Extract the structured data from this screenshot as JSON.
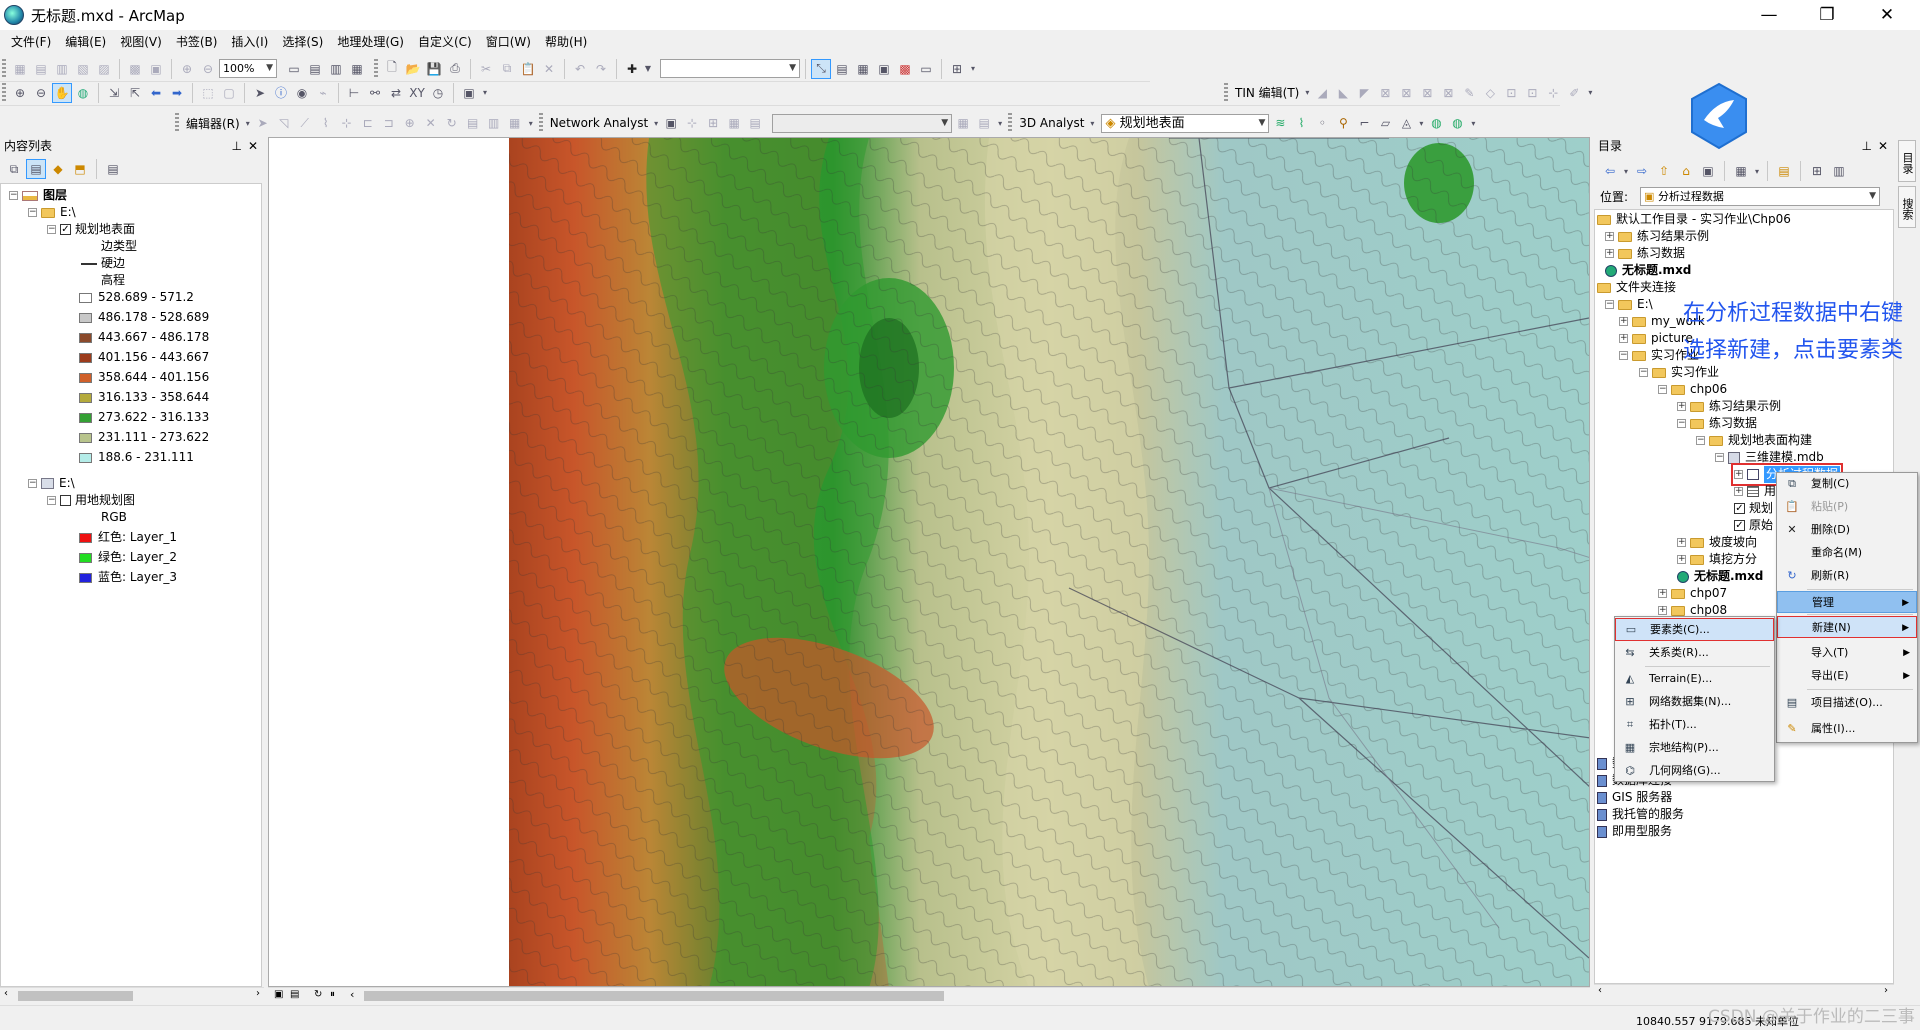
{
  "window": {
    "title": "无标题.mxd - ArcMap",
    "min": "—",
    "restore": "❐",
    "close": "✕"
  },
  "menu": [
    "文件(F)",
    "编辑(E)",
    "视图(V)",
    "书签(B)",
    "插入(I)",
    "选择(S)",
    "地理处理(G)",
    "自定义(C)",
    "窗口(W)",
    "帮助(H)"
  ],
  "toolbar": {
    "zoom": "100%",
    "tin_edit": "TIN 编辑(T)",
    "editor": "编辑器(R)",
    "network": "Network Analyst",
    "analyst3d": "3D Analyst",
    "layer": "规划地表面"
  },
  "toc": {
    "title": "内容列表",
    "root": "图层",
    "group1": "E:\\",
    "layer1": "规划地表面",
    "edge_type": "边类型",
    "hard_edge": "硬边",
    "elevation": "高程",
    "classes": [
      {
        "label": "528.689 - 571.2",
        "color": "#ffffff"
      },
      {
        "label": "486.178 - 528.689",
        "color": "#c8c8c8"
      },
      {
        "label": "443.667 - 486.178",
        "color": "#8b4a2b"
      },
      {
        "label": "401.156 - 443.667",
        "color": "#9c3c1c"
      },
      {
        "label": "358.644 - 401.156",
        "color": "#d0602a"
      },
      {
        "label": "316.133 - 358.644",
        "color": "#b4aa3c"
      },
      {
        "label": "273.622 - 316.133",
        "color": "#34a034"
      },
      {
        "label": "231.111 - 273.622",
        "color": "#b8c48c"
      },
      {
        "label": "188.6 - 231.111",
        "color": "#b4ece8"
      }
    ],
    "group2": "E:\\",
    "layer2": "用地规划图",
    "rgb": "RGB",
    "bands": [
      {
        "label": "红色:    Layer_1",
        "color": "#ee1111"
      },
      {
        "label": "绿色:  Layer_2",
        "color": "#22dd22"
      },
      {
        "label": "蓝色:    Layer_3",
        "color": "#2222dd"
      }
    ]
  },
  "catalog": {
    "title": "目录",
    "location_label": "位置:",
    "location_value": "分析过程数据",
    "items": [
      "默认工作目录 - 实习作业\\Chp06",
      "练习结果示例",
      "练习数据",
      "无标题.mxd",
      "文件夹连接",
      "E:\\",
      "my_work",
      "picture",
      "实习作业",
      "实习作业",
      "chp06",
      "练习结果示例",
      "练习数据",
      "规划地表面构建",
      "三维建模.mdb",
      "分析过程数据",
      "用",
      "规划",
      "原始",
      "坡度坡向",
      "填挖方分",
      "无标题.mxd",
      "chp07",
      "chp08",
      "数据库服务器",
      "数据库连接",
      "GIS 服务器",
      "我托管的服务",
      "即用型服务"
    ]
  },
  "annotation": {
    "line1": "在分析过程数据中右键",
    "line2": "选择新建，点击要素类"
  },
  "context_menu": {
    "copy": "复制(C)",
    "paste": "粘贴(P)",
    "delete": "删除(D)",
    "rename": "重命名(M)",
    "refresh": "刷新(R)",
    "manage": "管理",
    "new": "新建(N)",
    "import": "导入(T)",
    "export": "导出(E)",
    "item_desc": "项目描述(O)...",
    "properties": "属性(I)..."
  },
  "submenu_new": {
    "feature_class": "要素类(C)...",
    "relation_class": "关系类(R)...",
    "terrain": "Terrain(E)...",
    "network_dataset": "网络数据集(N)...",
    "topology": "拓扑(T)...",
    "parcel_fabric": "宗地结构(P)...",
    "geometric_network": "几何网络(G)..."
  },
  "side_tabs": [
    "目录",
    "搜索"
  ],
  "status": {
    "coords": "10840.557  9179.685 未知单位",
    "watermark": "CSDN @关于作业的二三事"
  },
  "colors": {
    "selection": "#3399ff",
    "highlight_box": "#e03030",
    "annotation_text": "#2255ee",
    "menu_hover": "#90c0f0"
  }
}
